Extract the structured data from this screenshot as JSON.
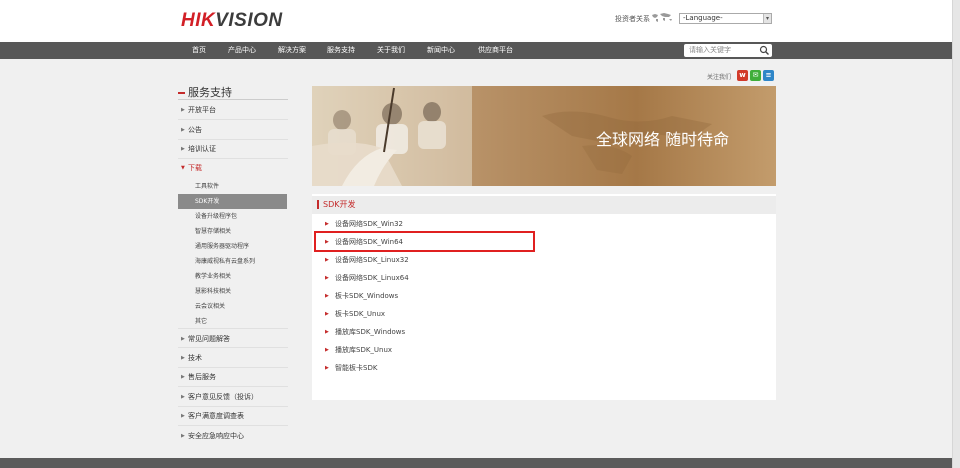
{
  "header": {
    "logo_red": "HIK",
    "logo_dark": "VISION",
    "investor_link": "投资者关系",
    "language": {
      "selected": "-Language-"
    }
  },
  "nav": {
    "items": [
      "首页",
      "产品中心",
      "解决方案",
      "服务支持",
      "关于我们",
      "新闻中心",
      "供应商平台"
    ],
    "search_placeholder": "请输入关键字"
  },
  "follow": {
    "label": "关注我们"
  },
  "sidebar": {
    "title": "服务支持",
    "items_top": [
      "开放平台",
      "公告",
      "培训认证",
      "下载"
    ],
    "sub_items": [
      "工具软件",
      "SDK开发",
      "设备升级程序包",
      "智慧存储相关",
      "通用服务器驱动程序",
      "海康威视私有云盘系列",
      "教学业务相关",
      "慧影科技相关",
      "云会议相关",
      "其它"
    ],
    "items_bottom": [
      "常见问题解答",
      "技术",
      "售后服务",
      "客户意见反馈（投诉）",
      "客户满意度调查表",
      "安全应急响应中心"
    ]
  },
  "banner": {
    "slogan": "全球网络  随时待命"
  },
  "panel": {
    "title": "SDK开发",
    "items": [
      "设备网络SDK_Win32",
      "设备网络SDK_Win64",
      "设备网络SDK_Linux32",
      "设备网络SDK_Linux64",
      "板卡SDK_Windows",
      "板卡SDK_Unux",
      "播放库SDK_Windows",
      "播放库SDK_Unux",
      "智能板卡SDK"
    ]
  },
  "colors": {
    "brand_red": "#d21f26",
    "nav_bg": "#575757",
    "accent": "#c42b2b"
  }
}
